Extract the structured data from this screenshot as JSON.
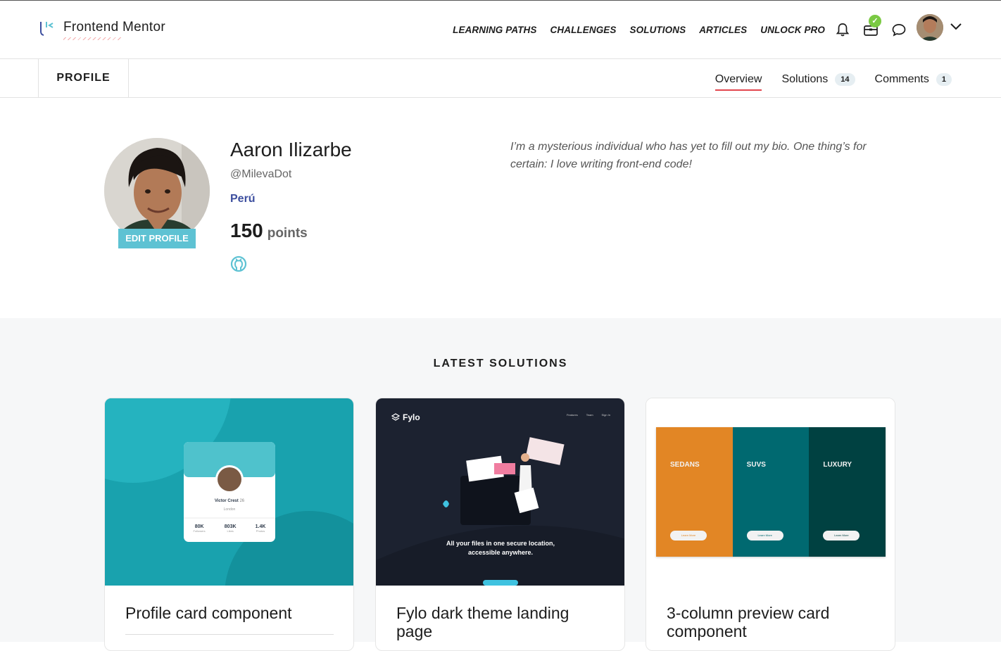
{
  "brand": {
    "name": "Frontend Mentor"
  },
  "nav": {
    "items": [
      "LEARNING PATHS",
      "CHALLENGES",
      "SOLUTIONS",
      "ARTICLES",
      "UNLOCK PRO"
    ]
  },
  "subnav": {
    "profile_label": "PROFILE",
    "tabs": [
      {
        "label": "Overview",
        "count": null,
        "active": true
      },
      {
        "label": "Solutions",
        "count": "14",
        "active": false
      },
      {
        "label": "Comments",
        "count": "1",
        "active": false
      }
    ]
  },
  "profile": {
    "name": "Aaron Ilizarbe",
    "handle": "@MilevaDot",
    "country": "Perú",
    "points_value": "150",
    "points_label": "points",
    "edit_label": "EDIT PROFILE",
    "bio": "I’m a mysterious individual who has yet to fill out my bio. One thing’s for certain: I love writing front-end code!"
  },
  "latest": {
    "title": "LATEST SOLUTIONS",
    "cards": [
      {
        "title": "Profile card component",
        "preview": {
          "person": "Victor Crest",
          "age": "26",
          "city": "London",
          "stats": [
            {
              "value": "80K",
              "label": "Followers"
            },
            {
              "value": "803K",
              "label": "Likes"
            },
            {
              "value": "1.4K",
              "label": "Photos"
            }
          ]
        }
      },
      {
        "title": "Fylo dark theme landing page",
        "preview": {
          "logo": "Fylo",
          "links": [
            "Features",
            "Team",
            "Sign In"
          ],
          "headline": "All your files in one secure location, accessible anywhere."
        }
      },
      {
        "title": "3-column preview card component",
        "preview": {
          "columns": [
            "SEDANS",
            "SUVS",
            "LUXURY"
          ],
          "button": "Learn More"
        }
      }
    ]
  },
  "colors": {
    "accent": "#e2464e",
    "teal": "#5ec2d3",
    "country": "#3d4f9f"
  }
}
